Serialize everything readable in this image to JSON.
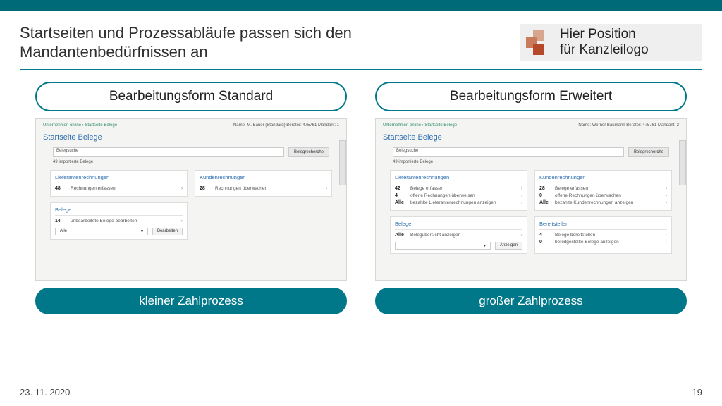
{
  "header": {
    "title": "Startseiten und Prozessabläufe passen sich den Mandantenbedürfnissen an",
    "logo_line1": "Hier Position",
    "logo_line2": "für Kanzleilogo"
  },
  "left": {
    "top_pill": "Bearbeitungsform Standard",
    "bottom_pill": "kleiner Zahlprozess",
    "shot": {
      "breadcrumb": "Unternehmen online  ›  Startseite Belege",
      "userline": "Name: M. Bauer (Standard)   Berater: 475761   Mandant: 1",
      "page_title": "Startseite Belege",
      "search_label": "Belegsuche",
      "search_btn": "Belegrecherche",
      "meta": "49 importierte Belege",
      "card1_h": "Lieferantenrechnungen",
      "card1_n": "48",
      "card1_t": "Rechnungen erfassen",
      "card2_h": "Kundenrechnungen",
      "card2_n": "28",
      "card2_t": "Rechnungen überwachen",
      "card3_h": "Belege",
      "card3_n": "14",
      "card3_t": "unbearbeitete Belege bearbeiten",
      "drop_val": "Alle",
      "btn": "Bearbeiten"
    }
  },
  "right": {
    "top_pill": "Bearbeitungsform Erweitert",
    "bottom_pill": "großer Zahlprozess",
    "shot": {
      "breadcrumb": "Unternehmen online  ›  Startseite Belege",
      "userline": "Name: Werner Baumann   Berater: 475761   Mandant: 2",
      "page_title": "Startseite Belege",
      "search_label": "Belegsuche",
      "search_btn": "Belegrecherche",
      "meta": "49 importierte Belege",
      "card1_h": "Lieferantenrechnungen",
      "c1a_n": "42",
      "c1a_t": "Belege erfassen",
      "c1b_n": "4",
      "c1b_t": "offene Rechnungen überweisen",
      "c1c_n": "Alle",
      "c1c_t": "bezahlte Lieferantenrechnungen anzeigen",
      "card2_h": "Kundenrechnungen",
      "c2a_n": "28",
      "c2a_t": "Belege erfassen",
      "c2b_n": "0",
      "c2b_t": "offene Rechnungen überwachen",
      "c2c_n": "Alle",
      "c2c_t": "bezahlte Kundenrechnungen anzeigen",
      "card3_h": "Belege",
      "c3_n": "Alle",
      "c3_t": "Belegübersicht anzeigen",
      "drop_val": "",
      "btn": "Anzeigen",
      "card4_h": "Bereitstellen",
      "c4a_n": "4",
      "c4a_t": "Belege bereitstellen",
      "c4b_n": "0",
      "c4b_t": "bereitgestellte Belege anzeigen"
    }
  },
  "footer": {
    "date": "23. 11. 2020",
    "page": "19"
  }
}
